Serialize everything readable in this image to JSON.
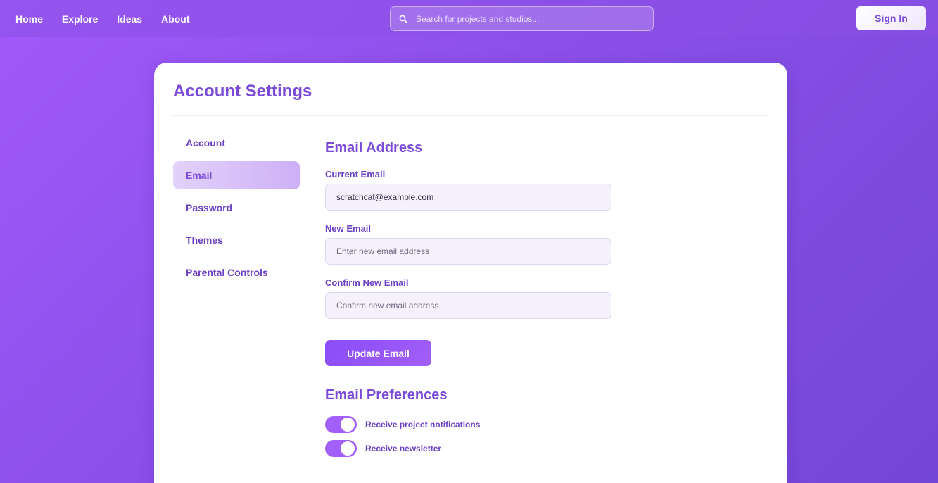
{
  "nav": {
    "items": [
      "Home",
      "Explore",
      "Ideas",
      "About"
    ]
  },
  "search": {
    "placeholder": "Search for projects and studios...",
    "icon": "search-icon"
  },
  "header": {
    "sign_in_label": "Sign In"
  },
  "card": {
    "title": "Account Settings"
  },
  "sidebar": {
    "items": [
      {
        "label": "Account",
        "active": false
      },
      {
        "label": "Email",
        "active": true
      },
      {
        "label": "Password",
        "active": false
      },
      {
        "label": "Themes",
        "active": false
      },
      {
        "label": "Parental Controls",
        "active": false
      }
    ]
  },
  "email_section": {
    "title": "Email Address",
    "current_label": "Current Email",
    "current_value": "scratchcat@example.com",
    "new_label": "New Email",
    "new_placeholder": "Enter new email address",
    "confirm_label": "Confirm New Email",
    "confirm_placeholder": "Confirm new email address",
    "update_button": "Update Email"
  },
  "preferences": {
    "title": "Email Preferences",
    "toggles": [
      {
        "label": "Receive project notifications",
        "on": true
      },
      {
        "label": "Receive newsletter",
        "on": true
      }
    ]
  },
  "colors": {
    "accent": "#7a4ad8",
    "toggle_on": "#a35ff9",
    "background": "#9a55f5"
  }
}
